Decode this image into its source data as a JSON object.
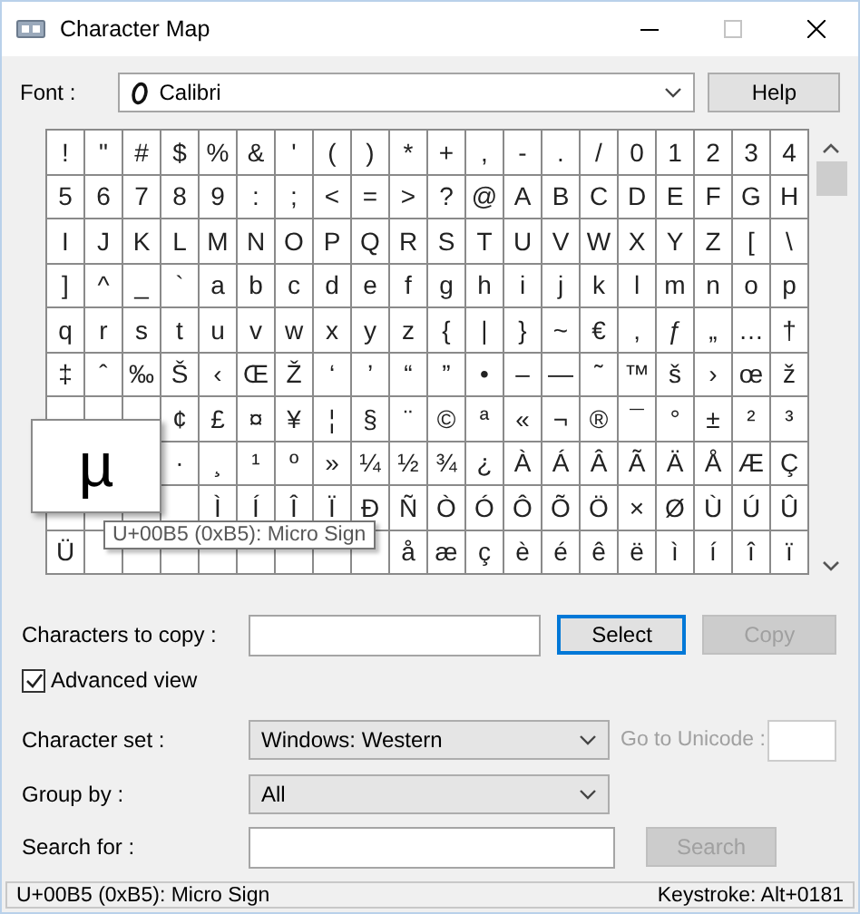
{
  "window": {
    "title": "Character Map"
  },
  "font": {
    "label": "Font :",
    "value": "Calibri"
  },
  "help_button": {
    "label": "Help"
  },
  "grid": {
    "rows": [
      [
        "!",
        "\"",
        "#",
        "$",
        "%",
        "&",
        "'",
        "(",
        ")",
        "*",
        "+",
        ",",
        "-",
        ".",
        "/",
        "0",
        "1",
        "2",
        "3",
        "4"
      ],
      [
        "5",
        "6",
        "7",
        "8",
        "9",
        ":",
        ";",
        "<",
        "=",
        ">",
        "?",
        "@",
        "A",
        "B",
        "C",
        "D",
        "E",
        "F",
        "G",
        "H"
      ],
      [
        "I",
        "J",
        "K",
        "L",
        "M",
        "N",
        "O",
        "P",
        "Q",
        "R",
        "S",
        "T",
        "U",
        "V",
        "W",
        "X",
        "Y",
        "Z",
        "[",
        "\\"
      ],
      [
        "]",
        "^",
        "_",
        "`",
        "a",
        "b",
        "c",
        "d",
        "e",
        "f",
        "g",
        "h",
        "i",
        "j",
        "k",
        "l",
        "m",
        "n",
        "o",
        "p"
      ],
      [
        "q",
        "r",
        "s",
        "t",
        "u",
        "v",
        "w",
        "x",
        "y",
        "z",
        "{",
        "|",
        "}",
        "~",
        "€",
        "‚",
        "ƒ",
        "„",
        "…",
        "†"
      ],
      [
        "‡",
        "ˆ",
        "‰",
        "Š",
        "‹",
        "Œ",
        "Ž",
        "‘",
        "’",
        "“",
        "”",
        "•",
        "–",
        "—",
        "˜",
        "™",
        "š",
        "›",
        "œ",
        "ž"
      ],
      [
        null,
        null,
        null,
        "¢",
        "£",
        "¤",
        "¥",
        "¦",
        "§",
        "¨",
        "©",
        "ª",
        "«",
        "¬",
        "®",
        "¯",
        "°",
        "±",
        "²",
        "³"
      ],
      [
        null,
        null,
        null,
        "·",
        "¸",
        "¹",
        "º",
        "»",
        "¼",
        "½",
        "¾",
        "¿",
        "À",
        "Á",
        "Â",
        "Ã",
        "Ä",
        "Å",
        "Æ",
        "Ç"
      ],
      [
        null,
        null,
        null,
        null,
        "Ì",
        "Í",
        "Î",
        "Ï",
        "Ð",
        "Ñ",
        "Ò",
        "Ó",
        "Ô",
        "Õ",
        "Ö",
        "×",
        "Ø",
        "Ù",
        "Ú",
        "Û"
      ],
      [
        "Ü",
        null,
        null,
        null,
        null,
        null,
        null,
        null,
        null,
        "å",
        "æ",
        "ç",
        "è",
        "é",
        "ê",
        "ë",
        "ì",
        "í",
        "î",
        "ï"
      ]
    ],
    "magnifier": {
      "char": "µ"
    },
    "tooltip": "U+00B5 (0xB5): Micro Sign"
  },
  "copy_row": {
    "label": "Characters to copy :",
    "buttons": [
      {
        "label": "Select",
        "disabled": false,
        "focused": true
      },
      {
        "label": "Copy",
        "disabled": true,
        "focused": false
      }
    ]
  },
  "advanced_view": {
    "label": "Advanced view",
    "checked": true
  },
  "character_set": {
    "label": "Character set :",
    "value": "Windows: Western"
  },
  "go_to_unicode": {
    "label": "Go to Unicode :",
    "disabled": true
  },
  "group_by": {
    "label": "Group by :",
    "value": "All"
  },
  "search_for": {
    "label": "Search for :",
    "button": {
      "label": "Search",
      "disabled": true
    }
  },
  "status_bar": {
    "description": "U+00B5 (0xB5): Micro Sign",
    "keystroke": "Keystroke: Alt+0181"
  }
}
